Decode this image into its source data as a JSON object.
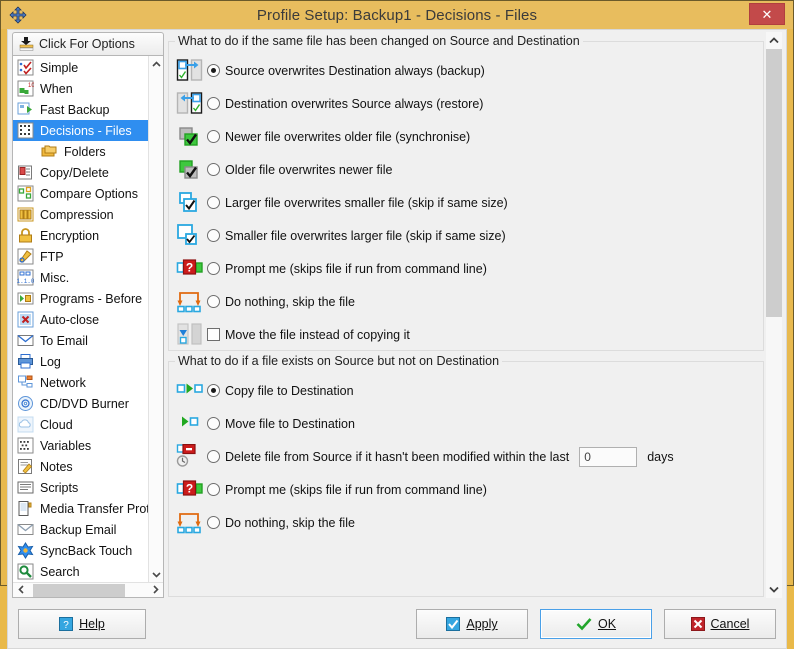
{
  "window": {
    "title": "Profile Setup: Backup1 - Decisions - Files",
    "system_icon": "move-icon",
    "close_label": "✕",
    "close_icon": "close-icon",
    "accent_color": "#e8bd5e",
    "close_color": "#c34a4a",
    "selection_color": "#2f8ef0"
  },
  "sidebar": {
    "header": {
      "label": "Click For Options",
      "icon": "options-list-icon"
    },
    "scroll_up_icon": "chevron-up-icon",
    "scroll_down_icon": "chevron-down-icon",
    "scroll_left_icon": "chevron-left-icon",
    "scroll_right_icon": "chevron-right-icon",
    "items": [
      {
        "label": "Simple",
        "icon": "simple-icon",
        "selected": false,
        "child": false
      },
      {
        "label": "When",
        "icon": "when-clock-icon",
        "selected": false,
        "child": false
      },
      {
        "label": "Fast Backup",
        "icon": "fast-backup-icon",
        "selected": false,
        "child": false
      },
      {
        "label": "Decisions - Files",
        "icon": "decisions-files-icon",
        "selected": true,
        "child": false
      },
      {
        "label": "Folders",
        "icon": "folders-icon",
        "selected": false,
        "child": true
      },
      {
        "label": "Copy/Delete",
        "icon": "copy-delete-icon",
        "selected": false,
        "child": false
      },
      {
        "label": "Compare Options",
        "icon": "compare-options-icon",
        "selected": false,
        "child": false
      },
      {
        "label": "Compression",
        "icon": "compression-icon",
        "selected": false,
        "child": false
      },
      {
        "label": "Encryption",
        "icon": "lock-icon",
        "selected": false,
        "child": false
      },
      {
        "label": "FTP",
        "icon": "ftp-icon",
        "selected": false,
        "child": false
      },
      {
        "label": "Misc.",
        "icon": "misc-icon",
        "selected": false,
        "child": false
      },
      {
        "label": "Programs - Before",
        "icon": "programs-before-icon",
        "selected": false,
        "child": false
      },
      {
        "label": "Auto-close",
        "icon": "auto-close-icon",
        "selected": false,
        "child": false
      },
      {
        "label": "To Email",
        "icon": "email-icon",
        "selected": false,
        "child": false
      },
      {
        "label": "Log",
        "icon": "log-printer-icon",
        "selected": false,
        "child": false
      },
      {
        "label": "Network",
        "icon": "network-icon",
        "selected": false,
        "child": false
      },
      {
        "label": "CD/DVD Burner",
        "icon": "disc-icon",
        "selected": false,
        "child": false
      },
      {
        "label": "Cloud",
        "icon": "cloud-icon",
        "selected": false,
        "child": false
      },
      {
        "label": "Variables",
        "icon": "variables-icon",
        "selected": false,
        "child": false
      },
      {
        "label": "Notes",
        "icon": "notes-pencil-icon",
        "selected": false,
        "child": false
      },
      {
        "label": "Scripts",
        "icon": "scripts-icon",
        "selected": false,
        "child": false
      },
      {
        "label": "Media Transfer Proto",
        "icon": "media-transfer-icon",
        "selected": false,
        "child": false
      },
      {
        "label": "Backup Email",
        "icon": "backup-email-icon",
        "selected": false,
        "child": false
      },
      {
        "label": "SyncBack Touch",
        "icon": "syncback-touch-icon",
        "selected": false,
        "child": false
      },
      {
        "label": "Search",
        "icon": "search-icon",
        "selected": false,
        "child": false
      }
    ]
  },
  "main": {
    "group1": {
      "title": "What to do if the same file has been changed on Source and Destination",
      "options": [
        {
          "label": "Source overwrites Destination always (backup)",
          "type": "radio",
          "checked": true,
          "icon": "source-to-destination-icon"
        },
        {
          "label": "Destination overwrites Source always (restore)",
          "type": "radio",
          "checked": false,
          "icon": "destination-to-source-icon"
        },
        {
          "label": "Newer file overwrites older file (synchronise)",
          "type": "radio",
          "checked": false,
          "icon": "newer-overwrites-older-icon"
        },
        {
          "label": "Older file overwrites newer file",
          "type": "radio",
          "checked": false,
          "icon": "older-overwrites-newer-icon"
        },
        {
          "label": "Larger file overwrites smaller file (skip if same size)",
          "type": "radio",
          "checked": false,
          "icon": "larger-overwrites-smaller-icon"
        },
        {
          "label": "Smaller file overwrites larger file (skip if same size)",
          "type": "radio",
          "checked": false,
          "icon": "smaller-overwrites-larger-icon"
        },
        {
          "label": "Prompt me (skips file if run from command line)",
          "type": "radio",
          "checked": false,
          "icon": "prompt-me-icon"
        },
        {
          "label": "Do nothing, skip the file",
          "type": "radio",
          "checked": false,
          "icon": "do-nothing-icon"
        },
        {
          "label": "Move the file instead of copying it",
          "type": "checkbox",
          "checked": false,
          "icon": "move-file-icon"
        }
      ]
    },
    "group2": {
      "title": "What to do if a file exists on Source but not on Destination",
      "options": [
        {
          "label": "Copy file to Destination",
          "type": "radio",
          "checked": true,
          "icon": "copy-file-icon"
        },
        {
          "label": "Move file to Destination",
          "type": "radio",
          "checked": false,
          "icon": "move-to-destination-icon"
        },
        {
          "label": "Delete file from Source if it hasn't been modified within the last",
          "type": "radio",
          "checked": false,
          "icon": "delete-after-days-icon"
        },
        {
          "label": "Prompt me  (skips file if run from command line)",
          "type": "radio",
          "checked": false,
          "icon": "prompt-me-icon"
        },
        {
          "label": "Do nothing, skip the file",
          "type": "radio",
          "checked": false,
          "icon": "do-nothing-icon"
        }
      ],
      "days_value": "0",
      "days_placeholder": "0",
      "days_label": "days"
    },
    "scroll_up_icon": "chevron-up-icon",
    "scroll_down_icon": "chevron-down-icon"
  },
  "footer": {
    "help_label": "Help",
    "help_icon": "help-question-icon",
    "apply_label": "Apply",
    "apply_icon": "apply-check-icon",
    "ok_label": "OK",
    "ok_icon": "ok-check-icon",
    "cancel_label": "Cancel",
    "cancel_icon": "cancel-x-icon"
  }
}
